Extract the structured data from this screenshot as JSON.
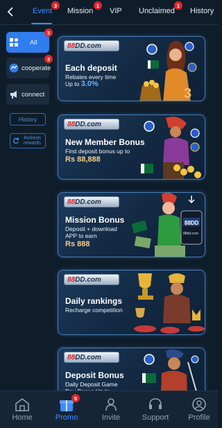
{
  "tabs": {
    "event": {
      "label": "Event",
      "badge": "3"
    },
    "mission": {
      "label": "Mission",
      "badge": "1"
    },
    "vip": {
      "label": "VIP"
    },
    "unclaimed": {
      "label": "Unclaimed",
      "badge": "1"
    },
    "history": {
      "label": "History"
    }
  },
  "sidebar": {
    "all": {
      "label": "All",
      "badge": "3"
    },
    "cooperate": {
      "label": "cooperate",
      "badge": "3"
    },
    "connect": {
      "label": "connect"
    },
    "history_button": "History",
    "refresh_button": "Refresh rewards"
  },
  "cards": [
    {
      "logo": "88DD.com",
      "logo_num": "88",
      "title": "Each deposit",
      "line1": "Rebates every time",
      "line2_prefix": "Up to ",
      "line2_value": "3.0%"
    },
    {
      "logo": "88DD.com",
      "logo_num": "88",
      "title": "New Member Bonus",
      "line1": "First deposit bonus up to",
      "amount": "Rs 88,888"
    },
    {
      "logo": "88DD.com",
      "logo_num": "88",
      "title": "Mission Bonus",
      "line1": "Deposit + download",
      "line2": "APP to earn",
      "amount": "Rs 888",
      "phone_label": "88DD",
      "phone_url": "88dd.com"
    },
    {
      "logo": "88DD.com",
      "logo_num": "88",
      "title": "Daily rankings",
      "line1": "Recharge competition"
    },
    {
      "logo": "88DD.com",
      "logo_num": "88",
      "title": "Deposit Bonus",
      "line1": "Daily Deposit Game",
      "line2": "Day Bonus Up to"
    }
  ],
  "bottom_nav": {
    "home": "Home",
    "promo": "Promo",
    "promo_badge": "5",
    "invite": "Invite",
    "support": "Support",
    "profile": "Profile"
  },
  "colors": {
    "accent": "#3f8cff",
    "badge": "#e0262d",
    "background": "#0f1d2b"
  }
}
